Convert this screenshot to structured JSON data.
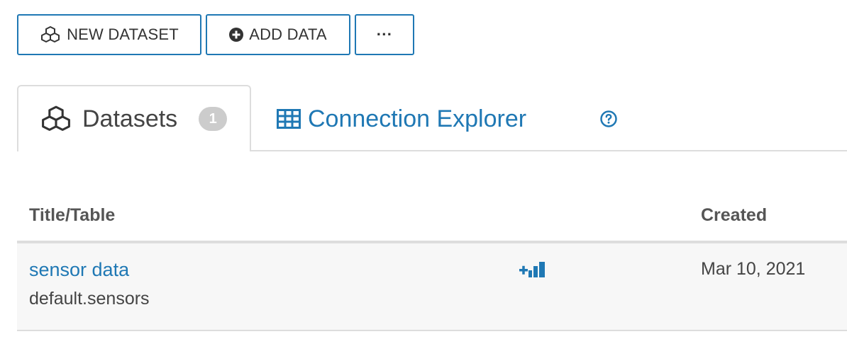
{
  "toolbar": {
    "new_dataset_label": "NEW DATASET",
    "add_data_label": "ADD DATA",
    "more_label": "···"
  },
  "tabs": {
    "datasets_label": "Datasets",
    "datasets_count": "1",
    "connection_explorer_label": "Connection Explorer"
  },
  "table": {
    "columns": [
      "Title/Table",
      "Created"
    ],
    "rows": [
      {
        "title": "sensor data",
        "table": "default.sensors",
        "created": "Mar 10, 2021"
      }
    ]
  },
  "icons": {
    "new_dataset": "cubes-icon",
    "add_data": "plus-circle-icon",
    "datasets_tab": "cubes-icon",
    "connection_explorer_tab": "table-icon",
    "help": "question-circle-icon",
    "row_action": "new-dashboard-icon"
  },
  "colors": {
    "accent": "#1f78b4",
    "badge": "#cccccc",
    "row_background": "#f7f7f7",
    "border": "#dddddd"
  }
}
